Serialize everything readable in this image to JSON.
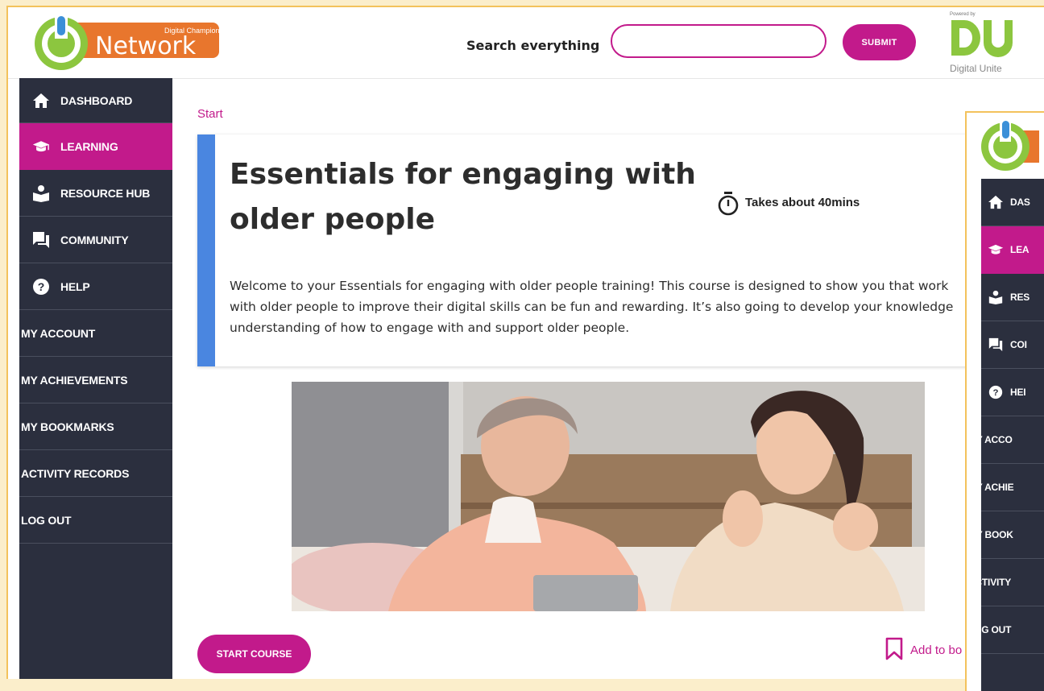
{
  "header": {
    "logo_small_text": "Digital Champions",
    "logo_text": "Network",
    "search_label": "Search everything",
    "search_value": "",
    "submit_label": "SUBMIT",
    "du_powered": "Powered by",
    "du_text": "Digital Unite"
  },
  "sidebar": {
    "items": [
      {
        "label": "DASHBOARD",
        "icon": "home-icon"
      },
      {
        "label": "LEARNING",
        "icon": "graduation-cap-icon",
        "active": true
      },
      {
        "label": "RESOURCE HUB",
        "icon": "resource-hub-icon"
      },
      {
        "label": "COMMUNITY",
        "icon": "chat-icon"
      },
      {
        "label": "HELP",
        "icon": "help-icon"
      },
      {
        "label": "MY ACCOUNT"
      },
      {
        "label": "MY ACHIEVEMENTS"
      },
      {
        "label": "MY BOOKMARKS"
      },
      {
        "label": "ACTIVITY RECORDS"
      },
      {
        "label": "LOG OUT"
      }
    ]
  },
  "main": {
    "breadcrumb": "Start",
    "course_title": "Essentials for engaging with older people",
    "duration": "Takes about 40mins",
    "intro_lines": [
      "Welcome to your Essentials for engaging with older people training! This course is designed to show you that work",
      "with older people to improve their digital skills can be fun and rewarding. It’s also going to develop your knowledge",
      "understanding of how to engage with and support older people."
    ],
    "start_button": "START COURSE",
    "bookmark_label": "Add to bo"
  },
  "overlay": {
    "items": [
      {
        "label": "DAS",
        "icon": "home-icon"
      },
      {
        "label": "LEA",
        "icon": "graduation-cap-icon",
        "active": true
      },
      {
        "label": "RES",
        "icon": "resource-hub-icon"
      },
      {
        "label": "COI",
        "icon": "chat-icon"
      },
      {
        "label": "HEI",
        "icon": "help-icon"
      },
      {
        "label": "MY ACCO"
      },
      {
        "label": "MY ACHIE"
      },
      {
        "label": "MY BOOK"
      },
      {
        "label": "ACTIVITY"
      },
      {
        "label": "LOG OUT"
      }
    ]
  },
  "colors": {
    "accent": "#c21a8b",
    "sidebar": "#2b2f3e",
    "card_border": "#4a86e0",
    "du_green": "#8cc63f",
    "logo_orange": "#e8762d"
  }
}
